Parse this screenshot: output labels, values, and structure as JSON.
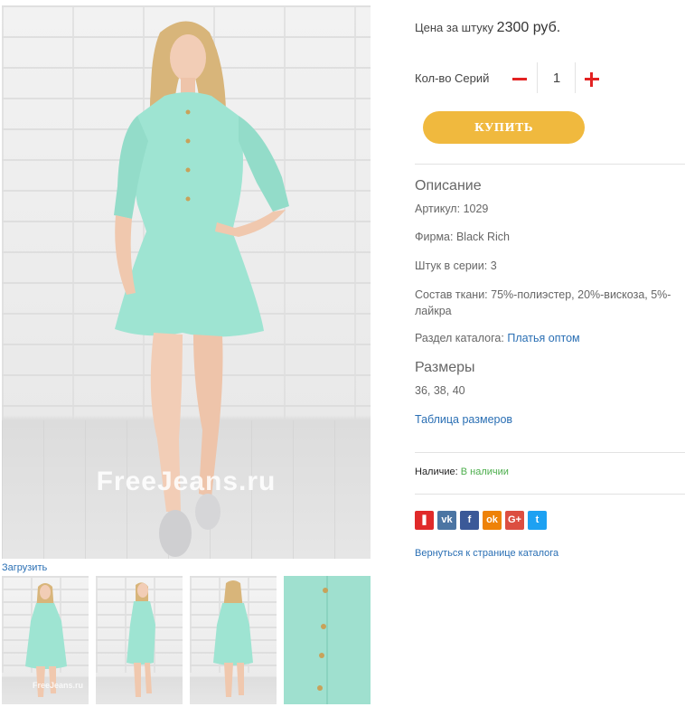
{
  "gallery": {
    "watermark": "FreeJeans.ru",
    "upload_label": "Загрузить",
    "thumb_watermark": "FreeJeans.ru"
  },
  "product": {
    "price_label": "Цена за штуку",
    "price_value": "2300 руб.",
    "qty_label": "Кол-во Серий",
    "qty_value": "1",
    "buy_label": "КУПИТЬ"
  },
  "description": {
    "title": "Описание",
    "article_label": "Артикул:",
    "article_value": "1029",
    "brand_label": "Фирма:",
    "brand_value": "Black Rich",
    "per_series_label": "Штук в серии:",
    "per_series_value": "3",
    "fabric_label": "Состав ткани:",
    "fabric_value": "75%-полиэстер, 20%-вискоза, 5%-лайкра",
    "catalog_label": "Раздел каталога:",
    "catalog_link": "Платья оптом"
  },
  "sizes": {
    "title": "Размеры",
    "values": "36, 38, 40",
    "table_link": "Таблица размеров"
  },
  "availability": {
    "label": "Наличие:",
    "status": "В наличии"
  },
  "share": [
    {
      "name": "bookmark-icon",
      "glyph": "❚",
      "color": "#e02a2a"
    },
    {
      "name": "vk-icon",
      "glyph": "vk",
      "color": "#4c75a3"
    },
    {
      "name": "facebook-icon",
      "glyph": "f",
      "color": "#3b5998"
    },
    {
      "name": "odnoklassniki-icon",
      "glyph": "ok",
      "color": "#ee8208"
    },
    {
      "name": "google-plus-icon",
      "glyph": "G+",
      "color": "#dc4e41"
    },
    {
      "name": "twitter-icon",
      "glyph": "t",
      "color": "#1da1f2"
    }
  ],
  "back_link": "Вернуться к странице каталога",
  "colors": {
    "accent": "#f0b93e",
    "link": "#2a6fb4",
    "in_stock": "#4cae4c",
    "qty_controls": "#e32222",
    "dress": "#9ee4d2"
  }
}
